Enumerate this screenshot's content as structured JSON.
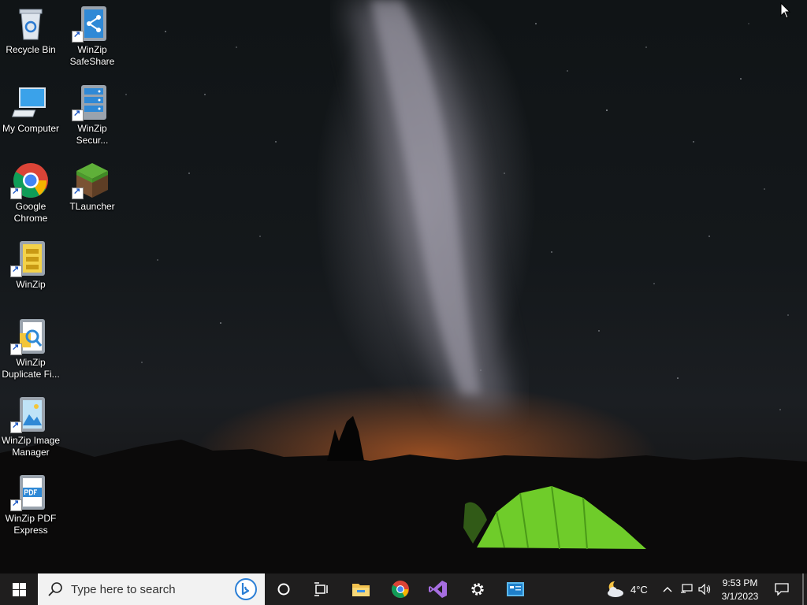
{
  "desktop": {
    "icons": [
      {
        "name": "recycle-bin",
        "lines": [
          "Recycle Bin"
        ]
      },
      {
        "name": "winzip-safeshare",
        "lines": [
          "WinZip",
          "SafeShare"
        ]
      },
      {
        "name": "my-computer",
        "lines": [
          "My Computer"
        ]
      },
      {
        "name": "winzip-secure",
        "lines": [
          "WinZip",
          "Secur..."
        ]
      },
      {
        "name": "google-chrome",
        "lines": [
          "Google",
          "Chrome"
        ]
      },
      {
        "name": "tlauncher",
        "lines": [
          "TLauncher"
        ]
      },
      {
        "name": "winzip",
        "lines": [
          "WinZip"
        ]
      },
      {
        "name": "winzip-duplicate-finder",
        "lines": [
          "WinZip",
          "Duplicate Fi..."
        ]
      },
      {
        "name": "winzip-image-manager",
        "lines": [
          "WinZip Image",
          "Manager"
        ]
      },
      {
        "name": "winzip-pdf-express",
        "lines": [
          "WinZip PDF",
          "Express"
        ]
      }
    ]
  },
  "taskbar": {
    "search_placeholder": "Type here to search",
    "apps": [
      "cortana-circle-icon",
      "task-view-icon",
      "file-explorer-icon",
      "chrome-icon",
      "visual-studio-icon",
      "settings-gear-icon",
      "control-panel-icon"
    ],
    "weather": {
      "temp": "4°C",
      "icon": "partly-cloudy-night-icon"
    },
    "clock": {
      "time": "9:53 PM",
      "date": "3/1/2023"
    }
  },
  "colors": {
    "taskbar_bg": "#1f1e1e",
    "accent": "#0078d7",
    "tent_green": "#7bd332"
  }
}
